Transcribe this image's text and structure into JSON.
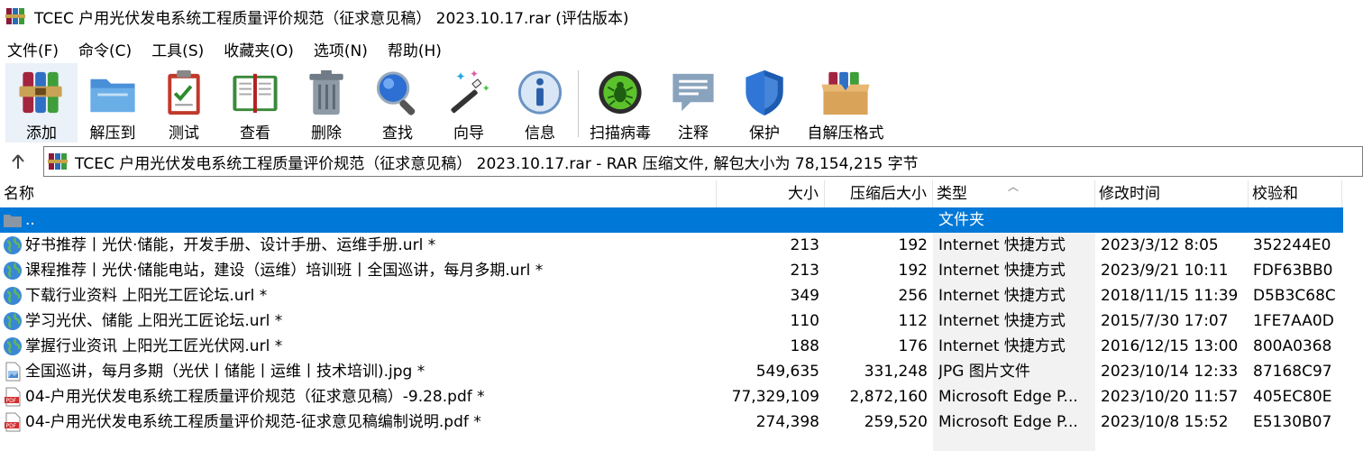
{
  "window": {
    "title": "TCEC 户用光伏发电系统工程质量评价规范（征求意见稿） 2023.10.17.rar (评估版本)"
  },
  "menu": {
    "items": [
      "文件(F)",
      "命令(C)",
      "工具(S)",
      "收藏夹(O)",
      "选项(N)",
      "帮助(H)"
    ]
  },
  "toolbar": {
    "items": [
      {
        "label": "添加",
        "icon": "add-archive-icon"
      },
      {
        "label": "解压到",
        "icon": "extract-folder-icon"
      },
      {
        "label": "测试",
        "icon": "test-clipboard-icon"
      },
      {
        "label": "查看",
        "icon": "view-book-icon"
      },
      {
        "label": "删除",
        "icon": "trash-icon"
      },
      {
        "label": "查找",
        "icon": "magnifier-icon"
      },
      {
        "label": "向导",
        "icon": "wizard-wand-icon"
      },
      {
        "label": "信息",
        "icon": "info-icon"
      },
      {
        "label": "扫描病毒",
        "icon": "virus-scan-icon"
      },
      {
        "label": "注释",
        "icon": "comment-icon"
      },
      {
        "label": "保护",
        "icon": "shield-icon"
      },
      {
        "label": "自解压格式",
        "icon": "sfx-box-icon"
      }
    ]
  },
  "address": {
    "path": "TCEC 户用光伏发电系统工程质量评价规范（征求意见稿） 2023.10.17.rar - RAR 压缩文件, 解包大小为 78,154,215 字节"
  },
  "columns": {
    "name": "名称",
    "size": "大小",
    "packed": "压缩后大小",
    "type": "类型",
    "modified": "修改时间",
    "crc": "校验和"
  },
  "files": [
    {
      "name": "..",
      "size": "",
      "packed": "",
      "type": "文件夹",
      "modified": "",
      "crc": "",
      "icon": "folder-icon"
    },
    {
      "name": "好书推荐丨光伏·储能，开发手册、设计手册、运维手册.url *",
      "size": "213",
      "packed": "192",
      "type": "Internet 快捷方式",
      "modified": "2023/3/12 8:05",
      "crc": "352244E0",
      "icon": "globe-icon"
    },
    {
      "name": "课程推荐丨光伏·储能电站，建设（运维）培训班丨全国巡讲，每月多期.url *",
      "size": "213",
      "packed": "192",
      "type": "Internet 快捷方式",
      "modified": "2023/9/21 10:11",
      "crc": "FDF63BB0",
      "icon": "globe-icon"
    },
    {
      "name": "下载行业资料 上阳光工匠论坛.url *",
      "size": "349",
      "packed": "256",
      "type": "Internet 快捷方式",
      "modified": "2018/11/15 11:39",
      "crc": "D5B3C68C",
      "icon": "globe-icon"
    },
    {
      "name": "学习光伏、储能 上阳光工匠论坛.url *",
      "size": "110",
      "packed": "112",
      "type": "Internet 快捷方式",
      "modified": "2015/7/30 17:07",
      "crc": "1FE7AA0D",
      "icon": "globe-icon"
    },
    {
      "name": "掌握行业资讯 上阳光工匠光伏网.url *",
      "size": "188",
      "packed": "176",
      "type": "Internet 快捷方式",
      "modified": "2016/12/15 13:00",
      "crc": "800A0368",
      "icon": "globe-icon"
    },
    {
      "name": "全国巡讲，每月多期（光伏丨储能丨运维丨技术培训).jpg *",
      "size": "549,635",
      "packed": "331,248",
      "type": "JPG 图片文件",
      "modified": "2023/10/14 12:33",
      "crc": "87168C97",
      "icon": "image-file-icon"
    },
    {
      "name": "04-户用光伏发电系统工程质量评价规范（征求意见稿）-9.28.pdf *",
      "size": "77,329,109",
      "packed": "2,872,160",
      "type": "Microsoft Edge P...",
      "modified": "2023/10/20 11:57",
      "crc": "405EC80E",
      "icon": "pdf-file-icon"
    },
    {
      "name": "04-户用光伏发电系统工程质量评价规范-征求意见稿编制说明.pdf *",
      "size": "274,398",
      "packed": "259,520",
      "type": "Microsoft Edge P...",
      "modified": "2023/10/8 15:52",
      "crc": "E5130B07",
      "icon": "pdf-file-icon"
    }
  ],
  "colors": {
    "selection": "#0078d7",
    "type_column_bg": "#f2f2f2"
  }
}
